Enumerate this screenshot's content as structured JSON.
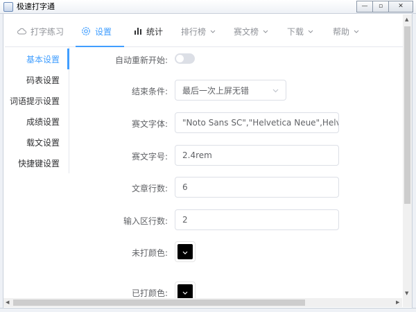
{
  "window": {
    "title": "极速打字通",
    "minimize": "—",
    "maximize": "▫",
    "close": "✕"
  },
  "nav": {
    "items": [
      {
        "label": "打字练习",
        "icon": "cloud-icon"
      },
      {
        "label": "设置",
        "icon": "gear-icon"
      },
      {
        "label": "统计",
        "icon": "bar-chart-icon"
      },
      {
        "label": "排行榜",
        "icon": "chevron-down-icon"
      },
      {
        "label": "赛文榜",
        "icon": "chevron-down-icon"
      },
      {
        "label": "下载",
        "icon": "chevron-down-icon"
      },
      {
        "label": "帮助",
        "icon": "chevron-down-icon"
      }
    ],
    "active_index": 1
  },
  "sidebar": {
    "items": [
      {
        "label": "基本设置"
      },
      {
        "label": "码表设置"
      },
      {
        "label": "词语提示设置"
      },
      {
        "label": "成绩设置"
      },
      {
        "label": "载文设置"
      },
      {
        "label": "快捷键设置"
      }
    ],
    "active_index": 0
  },
  "form": {
    "auto_restart": {
      "label": "自动重新开始:",
      "on": false
    },
    "end_condition": {
      "label": "结束条件:",
      "value": "最后一次上屏无错"
    },
    "race_font": {
      "label": "赛文字体:",
      "value": "\"Noto Sans SC\",\"Helvetica Neue\",Helvetica,\"P"
    },
    "race_font_size": {
      "label": "赛文字号:",
      "value": "2.4rem"
    },
    "article_lines": {
      "label": "文章行数:",
      "value": "6"
    },
    "input_lines": {
      "label": "输入区行数:",
      "value": "2"
    },
    "untyped_color": {
      "label": "未打颜色:",
      "color": "#000000"
    },
    "typed_color": {
      "label": "已打颜色:",
      "color": "#000000"
    }
  },
  "colors": {
    "accent": "#409eff",
    "text": "#606266",
    "border": "#dcdfe6"
  }
}
